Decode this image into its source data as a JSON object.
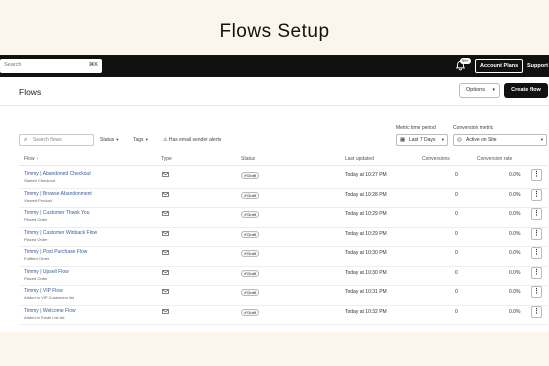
{
  "banner": {
    "title": "Flows Setup"
  },
  "topbar": {
    "search_placeholder": "Search",
    "search_shortcut": "⌘K",
    "notification_count": "99+",
    "account_plans_label": "Account Plans",
    "support_label": "Support"
  },
  "page": {
    "title": "Flows",
    "options_label": "Options",
    "create_flow_label": "Create flow"
  },
  "filters": {
    "search_placeholder": "Search flows",
    "status_label": "Status",
    "tags_label": "Tags",
    "email_senders_label": "Has email sender alerts",
    "time_period_label": "Metric time period",
    "time_period_value": "Last 7 Days",
    "conversion_metric_label": "Conversion metric",
    "conversion_metric_value": "Active on Site"
  },
  "table": {
    "headers": {
      "flow": "Flow ↑",
      "type": "Type",
      "status": "Status",
      "last_updated": "Last updated",
      "conversions": "Conversions",
      "conversion_rate": "Conversion rate"
    },
    "rows": [
      {
        "name": "Timmy | Abandoned Checkout",
        "trigger": "Started Checkout",
        "status": "Draft",
        "updated": "Today at 10:27 PM",
        "conversions": "0",
        "rate": "0.0%"
      },
      {
        "name": "Timmy | Browse Abandonment",
        "trigger": "Viewed Product",
        "status": "Draft",
        "updated": "Today at 10:28 PM",
        "conversions": "0",
        "rate": "0.0%"
      },
      {
        "name": "Timmy | Customer Thank You",
        "trigger": "Placed Order",
        "status": "Draft",
        "updated": "Today at 10:29 PM",
        "conversions": "0",
        "rate": "0.0%"
      },
      {
        "name": "Timmy | Customer Winback Flow",
        "trigger": "Placed Order",
        "status": "Draft",
        "updated": "Today at 10:29 PM",
        "conversions": "0",
        "rate": "0.0%"
      },
      {
        "name": "Timmy | Post Purchase Flow",
        "trigger": "Fulfilled Order",
        "status": "Draft",
        "updated": "Today at 10:30 PM",
        "conversions": "0",
        "rate": "0.0%"
      },
      {
        "name": "Timmy | Upsell Flow",
        "trigger": "Placed Order",
        "status": "Draft",
        "updated": "Today at 10:30 PM",
        "conversions": "0",
        "rate": "0.0%"
      },
      {
        "name": "Timmy | VIP Flow",
        "trigger": "Added to VIP Customers list",
        "status": "Draft",
        "updated": "Today at 10:31 PM",
        "conversions": "0",
        "rate": "0.0%"
      },
      {
        "name": "Timmy | Welcome Flow",
        "trigger": "Added to Email List list",
        "status": "Draft",
        "updated": "Today at 10:32 PM",
        "conversions": "0",
        "rate": "0.0%"
      }
    ]
  }
}
